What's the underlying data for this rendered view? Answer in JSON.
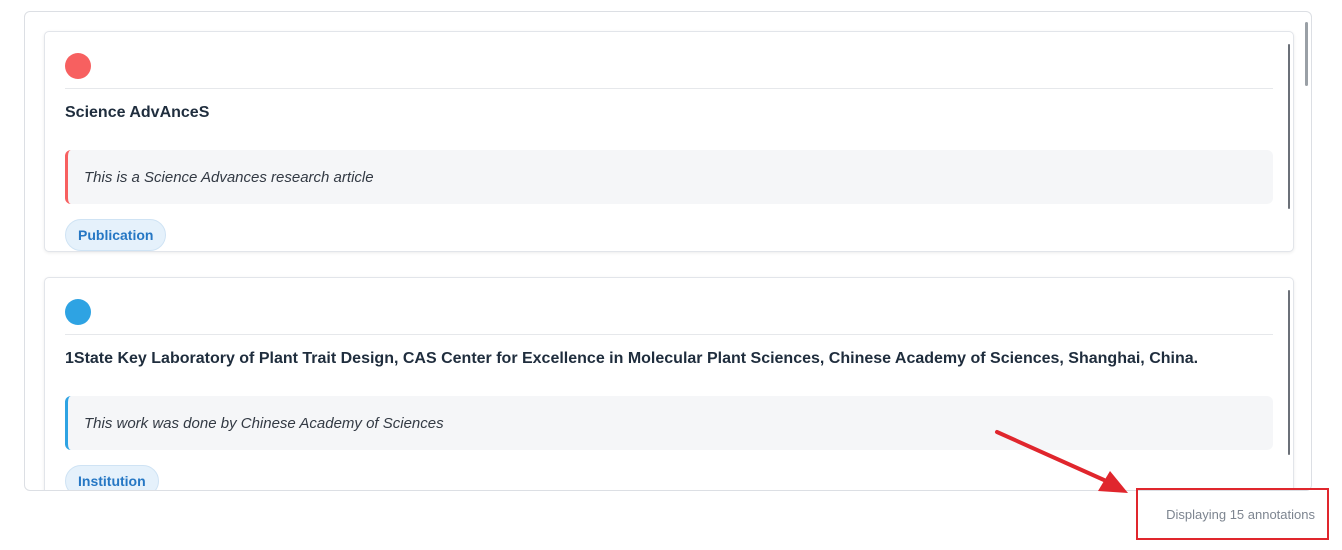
{
  "annotations": [
    {
      "title": "Science AdvAnceS",
      "note": "This is a Science Advances research article",
      "tag": "Publication",
      "color": "#f76060"
    },
    {
      "title": "1State Key Laboratory of Plant Trait Design, CAS Center for Excellence in Molecular Plant Sciences, Chinese Academy of Sciences, Shanghai, China.",
      "note": "This work was done by Chinese Academy of Sciences",
      "tag": "Institution",
      "color": "#2ea3e3"
    }
  ],
  "status": {
    "text": "Displaying 15 annotations"
  },
  "colors": {
    "highlight_red": "#e0262d",
    "tag_blue": "#2577c4"
  }
}
